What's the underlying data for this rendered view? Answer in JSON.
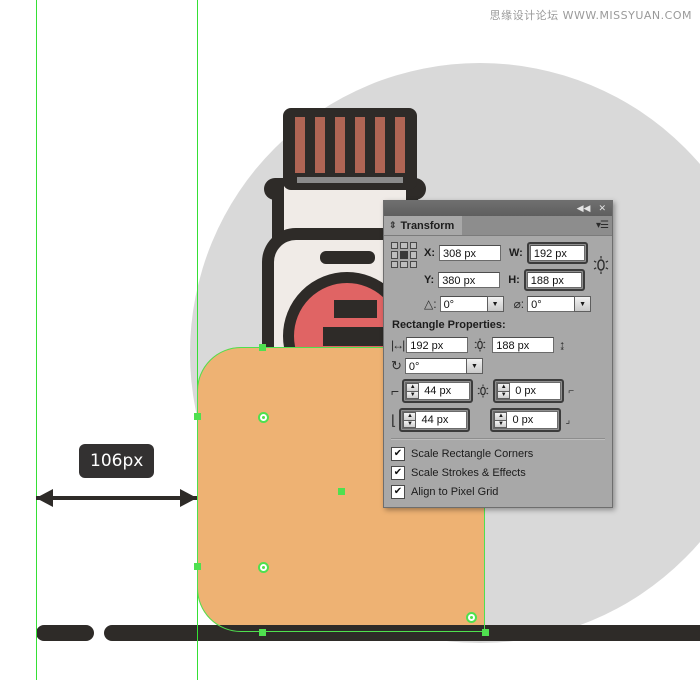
{
  "watermark": "思缘设计论坛  WWW.MISSYUAN.COM",
  "annotation": {
    "distance_label": "106px"
  },
  "panel": {
    "title": "Transform",
    "collapse_icon": "◀◀",
    "close_icon": "✕",
    "menu_icon": "▾☰",
    "grip_icon": "⇕",
    "reference_point_name": "reference-point-center",
    "fields": {
      "x_label": "X:",
      "x_value": "308 px",
      "y_label": "Y:",
      "y_value": "380 px",
      "w_label": "W:",
      "w_value": "192 px",
      "h_label": "H:",
      "h_value": "188 px",
      "rotate_label": "△:",
      "rotate_value": "0°",
      "shear_label": "⌀:",
      "shear_value": "0°"
    },
    "rectangle_properties": {
      "heading": "Rectangle Properties:",
      "width_value": "192 px",
      "height_value": "188 px",
      "angle_value": "0°",
      "corner_top_left": "44 px",
      "corner_top_right": "0 px",
      "corner_bottom_left": "44 px",
      "corner_bottom_right": "0 px"
    },
    "checkboxes": [
      {
        "label": "Scale Rectangle Corners",
        "checked": "✔"
      },
      {
        "label": "Scale Strokes & Effects",
        "checked": "✔"
      },
      {
        "label": "Align to Pixel Grid",
        "checked": "✔"
      }
    ]
  },
  "colors": {
    "orange_shape": "#eeb273",
    "gray_circle": "#d9d9d9",
    "dark_ink": "#2e2b28",
    "bottle_body": "#f0ebe7",
    "label_red": "#e06464",
    "cap_stripe": "#b06554",
    "guide_green": "#35e035",
    "selection_green": "#4fe04f",
    "panel_bg": "#a8a8a8"
  },
  "artwork": {
    "cap_stripe_count": 6
  }
}
